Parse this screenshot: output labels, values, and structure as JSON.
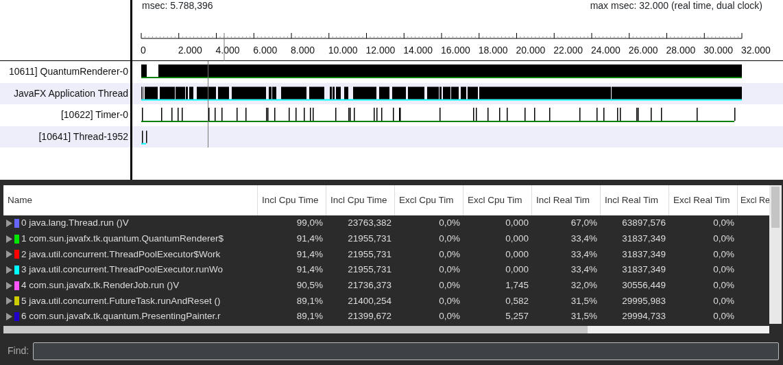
{
  "header": {
    "cursor_time": "msec: 5.788,396",
    "max_time": "max msec: 32.000 (real time, dual clock)"
  },
  "ruler": {
    "ticks": [
      "0",
      "2.000",
      "4.000",
      "6.000",
      "8.000",
      "10.000",
      "12.000",
      "14.000",
      "16.000",
      "18.000",
      "20.000",
      "22.000",
      "24.000",
      "26.000",
      "28.000",
      "30.000",
      "32.000"
    ]
  },
  "threads": [
    {
      "label": "10611] QuantumRenderer-0"
    },
    {
      "label": "JavaFX Application Thread"
    },
    {
      "label": "[10622] Timer-0"
    },
    {
      "label": "[10641] Thread-1952"
    }
  ],
  "table": {
    "columns": [
      "Name",
      "Incl Cpu Time",
      "Incl Cpu Time",
      "Excl Cpu Tim",
      "Excl Cpu Tim",
      "Incl Real Tim",
      "Incl Real Tim",
      "Excl Real Tim",
      "Excl Re"
    ],
    "rows": [
      {
        "expanded": false,
        "color": "#6666ff",
        "cells": [
          "0 java.lang.Thread.run ()V",
          "99,0%",
          "23763,382",
          "0,0%",
          "0,000",
          "67,0%",
          "63897,576",
          "0,0%"
        ]
      },
      {
        "expanded": false,
        "color": "#00e600",
        "cells": [
          "1 com.sun.javafx.tk.quantum.QuantumRenderer$",
          "91,4%",
          "21955,731",
          "0,0%",
          "0,000",
          "33,4%",
          "31837,349",
          "0,0%"
        ]
      },
      {
        "expanded": false,
        "color": "#ff0000",
        "cells": [
          "2 java.util.concurrent.ThreadPoolExecutor$Work",
          "91,4%",
          "21955,731",
          "0,0%",
          "0,000",
          "33,4%",
          "31837,349",
          "0,0%"
        ]
      },
      {
        "expanded": false,
        "color": "#00ffff",
        "cells": [
          "3 java.util.concurrent.ThreadPoolExecutor.runWo",
          "91,4%",
          "21955,731",
          "0,0%",
          "0,000",
          "33,4%",
          "31837,349",
          "0,0%"
        ]
      },
      {
        "expanded": false,
        "color": "#ff55ff",
        "cells": [
          "4 com.sun.javafx.tk.RenderJob.run ()V",
          "90,5%",
          "21736,373",
          "0,0%",
          "1,745",
          "32,0%",
          "30556,449",
          "0,0%"
        ]
      },
      {
        "expanded": false,
        "color": "#cccc00",
        "cells": [
          "5 java.util.concurrent.FutureTask.runAndReset ()",
          "89,1%",
          "21400,254",
          "0,0%",
          "0,582",
          "31,5%",
          "29995,983",
          "0,0%"
        ]
      },
      {
        "expanded": false,
        "color": "#2200cc",
        "cells": [
          "6 com.sun.javafx.tk.quantum.PresentingPainter.r",
          "89,1%",
          "21399,672",
          "0,0%",
          "5,257",
          "31,5%",
          "29994,733",
          "0,0%"
        ]
      }
    ]
  },
  "find": {
    "label": "Find:"
  }
}
